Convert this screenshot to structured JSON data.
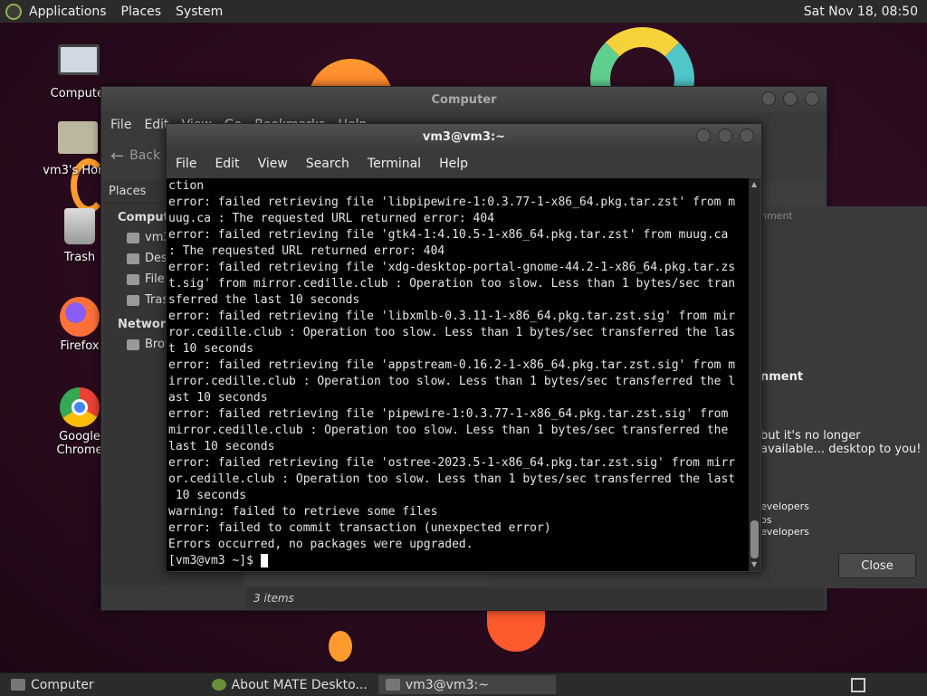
{
  "top_panel": {
    "menus": [
      "Applications",
      "Places",
      "System"
    ],
    "clock": "Sat Nov 18, 08:50"
  },
  "desktop_icons": [
    {
      "label": "Computer",
      "icon": "computer-icon"
    },
    {
      "label": "vm3's Home",
      "icon": "home-folder-icon"
    },
    {
      "label": "Trash",
      "icon": "trash-icon"
    },
    {
      "label": "Firefox",
      "icon": "firefox-icon"
    },
    {
      "label": "Google Chrome",
      "icon": "chrome-icon"
    }
  ],
  "file_manager": {
    "title": "Computer",
    "menu": [
      "File",
      "Edit",
      "View",
      "Go",
      "Bookmarks",
      "Help"
    ],
    "back_label": "Back",
    "side_header": "Places",
    "sections": [
      {
        "title": "Computer",
        "items": [
          "vm3",
          "Desktop",
          "File System",
          "Trash"
        ]
      },
      {
        "title": "Network",
        "items": [
          "Browse Network"
        ]
      }
    ],
    "status": "3 items"
  },
  "about_dialog": {
    "label_top": "nment",
    "label_env": "nment",
    "description": "but it's no longer available... desktop to you!",
    "credits": [
      "evelopers",
      "os",
      "evelopers"
    ],
    "close_label": "Close"
  },
  "terminal": {
    "title": "vm3@vm3:~",
    "menu": [
      "File",
      "Edit",
      "View",
      "Search",
      "Terminal",
      "Help"
    ],
    "lines": [
      "ction",
      "error: failed retrieving file 'libpipewire-1:0.3.77-1-x86_64.pkg.tar.zst' from m",
      "uug.ca : The requested URL returned error: 404",
      "error: failed retrieving file 'gtk4-1:4.10.5-1-x86_64.pkg.tar.zst' from muug.ca",
      ": The requested URL returned error: 404",
      "error: failed retrieving file 'xdg-desktop-portal-gnome-44.2-1-x86_64.pkg.tar.zs",
      "t.sig' from mirror.cedille.club : Operation too slow. Less than 1 bytes/sec tran",
      "sferred the last 10 seconds",
      "error: failed retrieving file 'libxmlb-0.3.11-1-x86_64.pkg.tar.zst.sig' from mir",
      "ror.cedille.club : Operation too slow. Less than 1 bytes/sec transferred the las",
      "t 10 seconds",
      "error: failed retrieving file 'appstream-0.16.2-1-x86_64.pkg.tar.zst.sig' from m",
      "irror.cedille.club : Operation too slow. Less than 1 bytes/sec transferred the l",
      "ast 10 seconds",
      "error: failed retrieving file 'pipewire-1:0.3.77-1-x86_64.pkg.tar.zst.sig' from",
      "mirror.cedille.club : Operation too slow. Less than 1 bytes/sec transferred the",
      "last 10 seconds",
      "error: failed retrieving file 'ostree-2023.5-1-x86_64.pkg.tar.zst.sig' from mirr",
      "or.cedille.club : Operation too slow. Less than 1 bytes/sec transferred the last",
      " 10 seconds",
      "warning: failed to retrieve some files",
      "error: failed to commit transaction (unexpected error)",
      "Errors occurred, no packages were upgraded."
    ],
    "prompt": "[vm3@vm3 ~]$ "
  },
  "taskbar": {
    "items": [
      {
        "label": "Computer",
        "active": false
      },
      {
        "label": "About MATE Deskto...",
        "active": false
      },
      {
        "label": "vm3@vm3:~",
        "active": true
      }
    ]
  }
}
